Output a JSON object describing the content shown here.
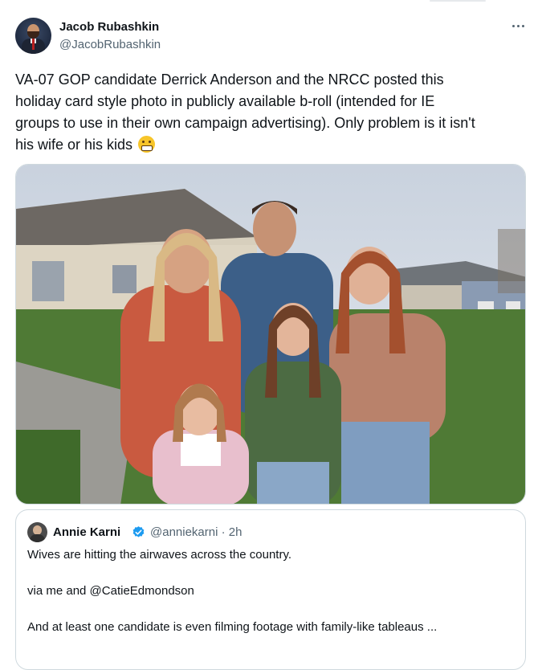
{
  "tweet": {
    "author_name": "Jacob Rubashkin",
    "author_handle": "@JacobRubashkin",
    "text_lines": [
      "VA-07 GOP candidate Derrick Anderson and the NRCC posted this",
      "holiday card style photo in publicly available b-roll (intended for IE",
      "groups to use in their own campaign advertising). Only problem is it isn't",
      "his wife or his kids"
    ],
    "emoji": "grimacing-face-emoji",
    "more_icon": "more-options-icon",
    "media_alt": "Photo of a man, a woman and three girls posing in front of houses"
  },
  "quote": {
    "author_name": "Annie Karni",
    "verified_icon": "verified-badge-icon",
    "verified_color": "#1d9bf0",
    "author_handle": "@anniekarni",
    "time": "· 2h",
    "paragraphs": [
      "Wives are hitting the airwaves across the country.",
      "via me and @CatieEdmondson",
      "And at least one candidate is even filming footage with family-like tableaus ..."
    ]
  }
}
